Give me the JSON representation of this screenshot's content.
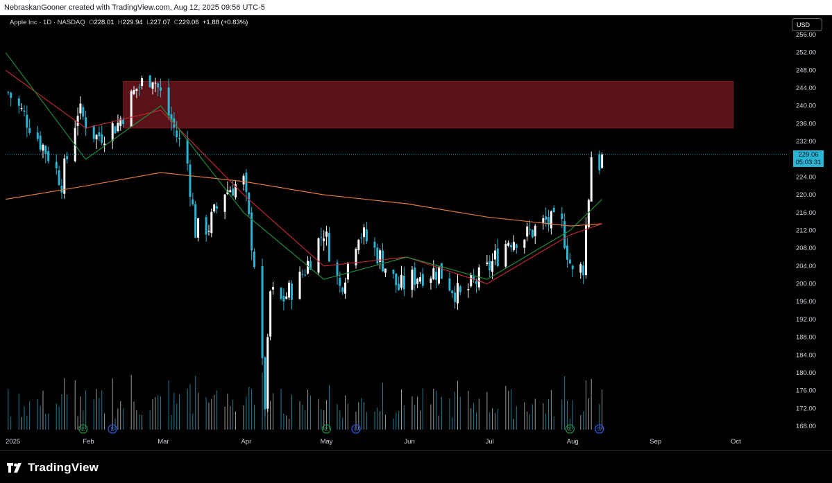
{
  "header": {
    "attribution": "NebraskanGooner created with TradingView.com, Aug 12, 2025 09:56 UTC-5"
  },
  "legend": {
    "symbol": "Apple Inc · 1D · NASDAQ",
    "open_label": "O",
    "open": "228.01",
    "high_label": "H",
    "high": "229.94",
    "low_label": "L",
    "low": "227.07",
    "close_label": "C",
    "close": "229.06",
    "change": "+1.88 (+0.83%)"
  },
  "currency_button": "USD",
  "last_price": {
    "value": "229.06",
    "countdown": "05:03:31"
  },
  "footer": {
    "brand": "TradingView"
  },
  "colors": {
    "background": "#000000",
    "up": "#ffffff",
    "down": "#2ab4d4",
    "zone": "#5a1118",
    "ma_long": "#e07a3a",
    "ma_mid": "#c0262f",
    "ma_short": "#1f8a3c",
    "axis_text": "#d1d4dc"
  },
  "chart_data": {
    "type": "candlestick",
    "symbol": "AAPL",
    "timeframe": "1D",
    "ylim": [
      166,
      258
    ],
    "y_ticks": [
      "256.00",
      "252.00",
      "248.00",
      "244.00",
      "240.00",
      "236.00",
      "232.00",
      "228.00",
      "224.00",
      "220.00",
      "216.00",
      "212.00",
      "208.00",
      "204.00",
      "200.00",
      "196.00",
      "192.00",
      "188.00",
      "184.00",
      "180.00",
      "176.00",
      "172.00",
      "168.00"
    ],
    "x_ticks": [
      "2025",
      "Feb",
      "Mar",
      "Apr",
      "May",
      "Jun",
      "Jul",
      "Aug",
      "Sep",
      "Oct"
    ],
    "resistance_zone": {
      "top": 245.5,
      "bottom": 235.0,
      "from": "2025-02-14",
      "to": "2025-09-30"
    },
    "last_price": 229.06,
    "close_path": [
      {
        "date": "2025-01-02",
        "close": 243
      },
      {
        "date": "2025-01-10",
        "close": 236
      },
      {
        "date": "2025-01-17",
        "close": 229
      },
      {
        "date": "2025-01-22",
        "close": 223
      },
      {
        "date": "2025-01-28",
        "close": 239
      },
      {
        "date": "2025-02-04",
        "close": 233
      },
      {
        "date": "2025-02-12",
        "close": 236
      },
      {
        "date": "2025-02-19",
        "close": 244
      },
      {
        "date": "2025-02-25",
        "close": 247
      },
      {
        "date": "2025-03-03",
        "close": 238
      },
      {
        "date": "2025-03-10",
        "close": 227
      },
      {
        "date": "2025-03-13",
        "close": 212
      },
      {
        "date": "2025-03-18",
        "close": 213
      },
      {
        "date": "2025-03-24",
        "close": 221
      },
      {
        "date": "2025-03-31",
        "close": 223
      },
      {
        "date": "2025-04-04",
        "close": 205
      },
      {
        "date": "2025-04-08",
        "close": 173
      },
      {
        "date": "2025-04-10",
        "close": 198
      },
      {
        "date": "2025-04-14",
        "close": 196
      },
      {
        "date": "2025-04-21",
        "close": 201
      },
      {
        "date": "2025-04-30",
        "close": 212
      },
      {
        "date": "2025-05-06",
        "close": 199
      },
      {
        "date": "2025-05-13",
        "close": 212
      },
      {
        "date": "2025-05-21",
        "close": 206
      },
      {
        "date": "2025-05-28",
        "close": 199
      },
      {
        "date": "2025-06-04",
        "close": 202
      },
      {
        "date": "2025-06-12",
        "close": 203
      },
      {
        "date": "2025-06-20",
        "close": 197
      },
      {
        "date": "2025-06-30",
        "close": 203
      },
      {
        "date": "2025-07-08",
        "close": 210
      },
      {
        "date": "2025-07-15",
        "close": 211
      },
      {
        "date": "2025-07-22",
        "close": 214
      },
      {
        "date": "2025-07-28",
        "close": 213
      },
      {
        "date": "2025-08-01",
        "close": 202
      },
      {
        "date": "2025-08-05",
        "close": 204
      },
      {
        "date": "2025-08-06",
        "close": 213
      },
      {
        "date": "2025-08-07",
        "close": 220
      },
      {
        "date": "2025-08-08",
        "close": 229
      },
      {
        "date": "2025-08-11",
        "close": 227
      },
      {
        "date": "2025-08-12",
        "close": 229.06
      }
    ],
    "ma_long": [
      {
        "date": "2025-01-01",
        "value": 219
      },
      {
        "date": "2025-01-31",
        "value": 222
      },
      {
        "date": "2025-02-28",
        "value": 225
      },
      {
        "date": "2025-03-31",
        "value": 223
      },
      {
        "date": "2025-04-30",
        "value": 220
      },
      {
        "date": "2025-05-31",
        "value": 218
      },
      {
        "date": "2025-06-30",
        "value": 215
      },
      {
        "date": "2025-07-31",
        "value": 213
      },
      {
        "date": "2025-08-12",
        "value": 213.5
      }
    ],
    "ma_mid": [
      {
        "date": "2025-01-01",
        "value": 248
      },
      {
        "date": "2025-01-31",
        "value": 235
      },
      {
        "date": "2025-02-28",
        "value": 239
      },
      {
        "date": "2025-03-31",
        "value": 220
      },
      {
        "date": "2025-04-30",
        "value": 204
      },
      {
        "date": "2025-05-31",
        "value": 206
      },
      {
        "date": "2025-06-30",
        "value": 200
      },
      {
        "date": "2025-07-31",
        "value": 211
      },
      {
        "date": "2025-08-12",
        "value": 213.5
      }
    ],
    "ma_short": [
      {
        "date": "2025-01-01",
        "value": 252
      },
      {
        "date": "2025-01-31",
        "value": 228
      },
      {
        "date": "2025-02-28",
        "value": 240
      },
      {
        "date": "2025-03-31",
        "value": 216
      },
      {
        "date": "2025-04-30",
        "value": 201
      },
      {
        "date": "2025-05-31",
        "value": 206
      },
      {
        "date": "2025-06-30",
        "value": 201
      },
      {
        "date": "2025-07-31",
        "value": 212
      },
      {
        "date": "2025-08-12",
        "value": 219
      }
    ],
    "events": [
      {
        "label": "E",
        "date": "2025-01-30"
      },
      {
        "label": "D",
        "date": "2025-02-10"
      },
      {
        "label": "E",
        "date": "2025-05-01"
      },
      {
        "label": "D",
        "date": "2025-05-12"
      },
      {
        "label": "E",
        "date": "2025-07-31"
      },
      {
        "label": "D",
        "date": "2025-08-11"
      }
    ]
  }
}
